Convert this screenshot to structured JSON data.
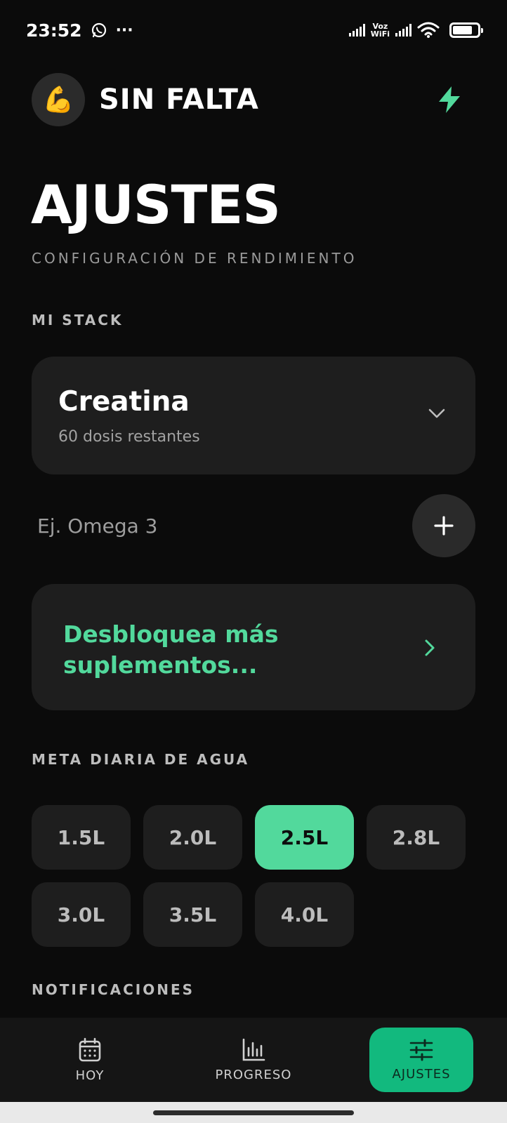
{
  "status_bar": {
    "time": "23:52",
    "icons": [
      "whatsapp-icon",
      "more-notifications-icon",
      "signal-icon",
      "voz-wifi-icon",
      "signal-icon",
      "wifi-icon",
      "battery-icon"
    ],
    "voz_line1": "Voz",
    "voz_line2": "WiFi",
    "more": "···"
  },
  "header": {
    "avatar_emoji": "💪",
    "brand": "SIN FALTA",
    "accent_color": "#52d99c"
  },
  "page": {
    "title": "AJUSTES",
    "subtitle": "CONFIGURACIÓN DE RENDIMIENTO"
  },
  "stack": {
    "section_label": "MI STACK",
    "item_name": "Creatina",
    "item_doses": "60 dosis restantes",
    "add_placeholder": "Ej. Omega 3",
    "unlock_text": "Desbloquea más suplementos..."
  },
  "water": {
    "section_label": "META DIARIA DE AGUA",
    "options": [
      "1.5L",
      "2.0L",
      "2.5L",
      "2.8L",
      "3.0L",
      "3.5L",
      "4.0L"
    ],
    "selected": "2.5L"
  },
  "notifications": {
    "section_label": "NOTIFICACIONES"
  },
  "nav": {
    "items": [
      {
        "label": "HOY",
        "icon": "calendar-icon"
      },
      {
        "label": "PROGRESO",
        "icon": "bar-chart-icon"
      },
      {
        "label": "AJUSTES",
        "icon": "sliders-icon"
      }
    ],
    "active": "AJUSTES",
    "active_color": "#12b97e"
  }
}
